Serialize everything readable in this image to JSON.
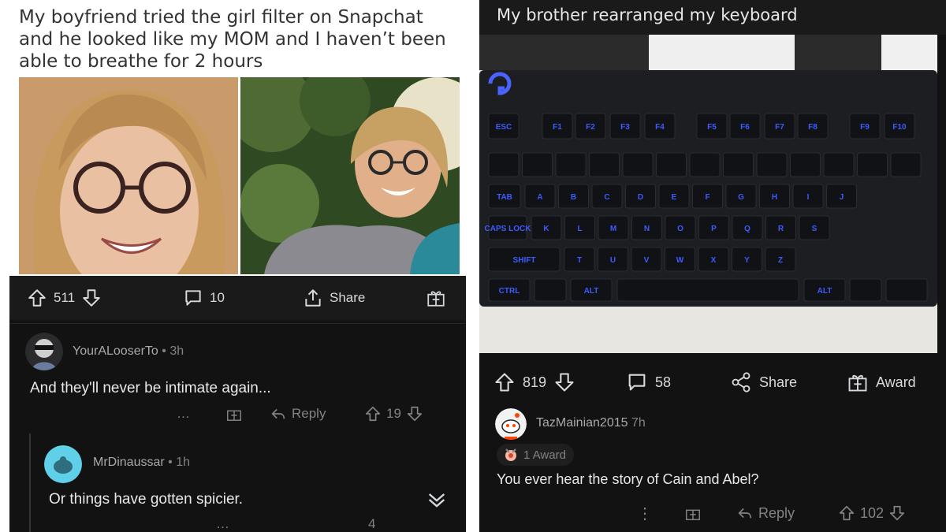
{
  "left": {
    "title": "My boyfriend tried the girl filter on Snapchat and he looked like my MOM and I haven’t been able to breathe for 2 hours",
    "actions": {
      "upvotes": "511",
      "comments": "10",
      "share": "Share"
    },
    "comments": [
      {
        "user": "YourALooserTo",
        "age": "3h",
        "text": "And they'll never be intimate again...",
        "more": "…",
        "reply": "Reply",
        "votes": "19"
      },
      {
        "user": "MrDinaussar",
        "age": "1h",
        "text": "Or things have gotten spicier.",
        "more": "…",
        "votes": "4"
      }
    ],
    "sep": "•"
  },
  "right": {
    "title": "My brother rearranged my keyboard",
    "keyboard": {
      "fkeys": [
        "ESC",
        "F1",
        "F2",
        "F3",
        "F4",
        "F5",
        "F6",
        "F7",
        "F8",
        "F9",
        "F10"
      ],
      "row2": [
        "A",
        "B",
        "C",
        "D",
        "E",
        "F",
        "G",
        "H",
        "I",
        "J"
      ],
      "row3": [
        "K",
        "L",
        "M",
        "N",
        "O",
        "P",
        "Q",
        "R",
        "S"
      ],
      "row4": [
        "T",
        "U",
        "V",
        "W",
        "X",
        "Y",
        "Z"
      ],
      "mods": [
        "TAB",
        "CAPS LOCK",
        "SHIFT",
        "CTRL",
        "ALT",
        "ALT"
      ]
    },
    "actions": {
      "upvotes": "819",
      "comments": "58",
      "share": "Share",
      "award": "Award"
    },
    "comment": {
      "user": "TazMainian2015",
      "age": "7h",
      "award_badge": "1 Award",
      "text": "You ever hear the story of Cain and Abel?",
      "more": "⋮",
      "reply": "Reply",
      "votes": "102"
    }
  },
  "colors": {
    "bg_dark": "#121213",
    "bar": "#1a1a1b",
    "text": "#d7dadc",
    "meta": "#818384",
    "key_glow": "#3d5bff"
  }
}
